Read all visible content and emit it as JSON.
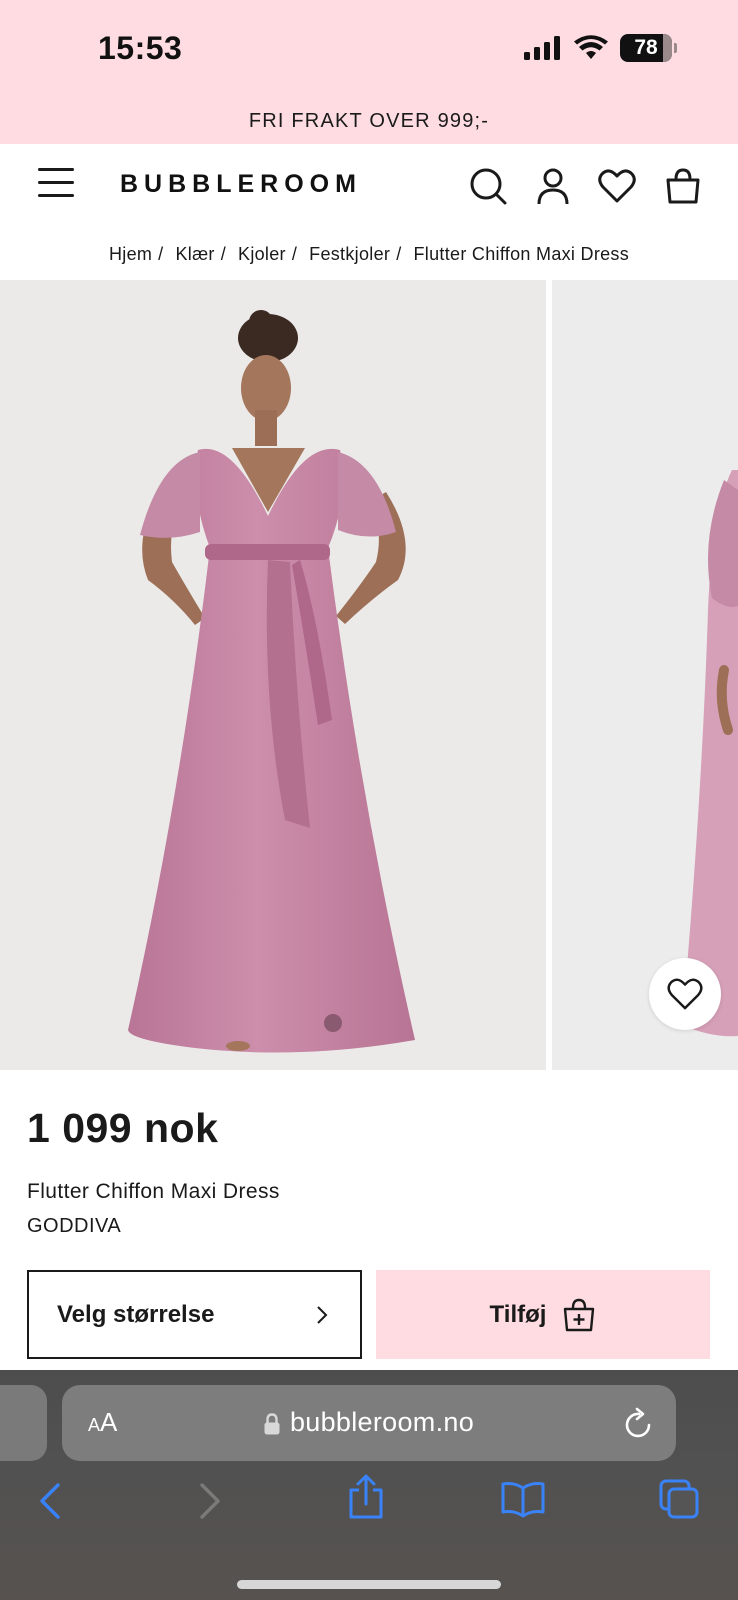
{
  "status_bar": {
    "time": "15:53",
    "battery": "78",
    "icons": [
      "cellular-signal-icon",
      "wifi-icon",
      "battery-icon"
    ]
  },
  "promo_banner": {
    "text": "FRI FRAKT OVER 999;-"
  },
  "header": {
    "logo": "BUBBLEROOM",
    "icons": [
      "menu-icon",
      "search-icon",
      "account-icon",
      "wishlist-icon",
      "bag-icon"
    ]
  },
  "breadcrumb": {
    "items": [
      "Hjem",
      "Klær",
      "Kjoler",
      "Festkjoler",
      "Flutter Chiffon Maxi Dress"
    ],
    "separator": "/"
  },
  "product": {
    "price": "1 099 nok",
    "name": "Flutter Chiffon Maxi Dress",
    "brand": "GODDIVA",
    "size_button_label": "Velg størrelse",
    "add_button_label": "Tilføj",
    "wishlist_icon": "heart-icon"
  },
  "browser": {
    "aa_label_small": "A",
    "aa_label_large": "A",
    "url": "bubbleroom.no",
    "toolbar": [
      "back-icon",
      "forward-icon",
      "share-icon",
      "bookmarks-icon",
      "tabs-icon"
    ]
  },
  "colors": {
    "banner_pink": "#fedce1",
    "dress_mauve": "#c88aa8",
    "ios_blue": "#3a82f7"
  }
}
